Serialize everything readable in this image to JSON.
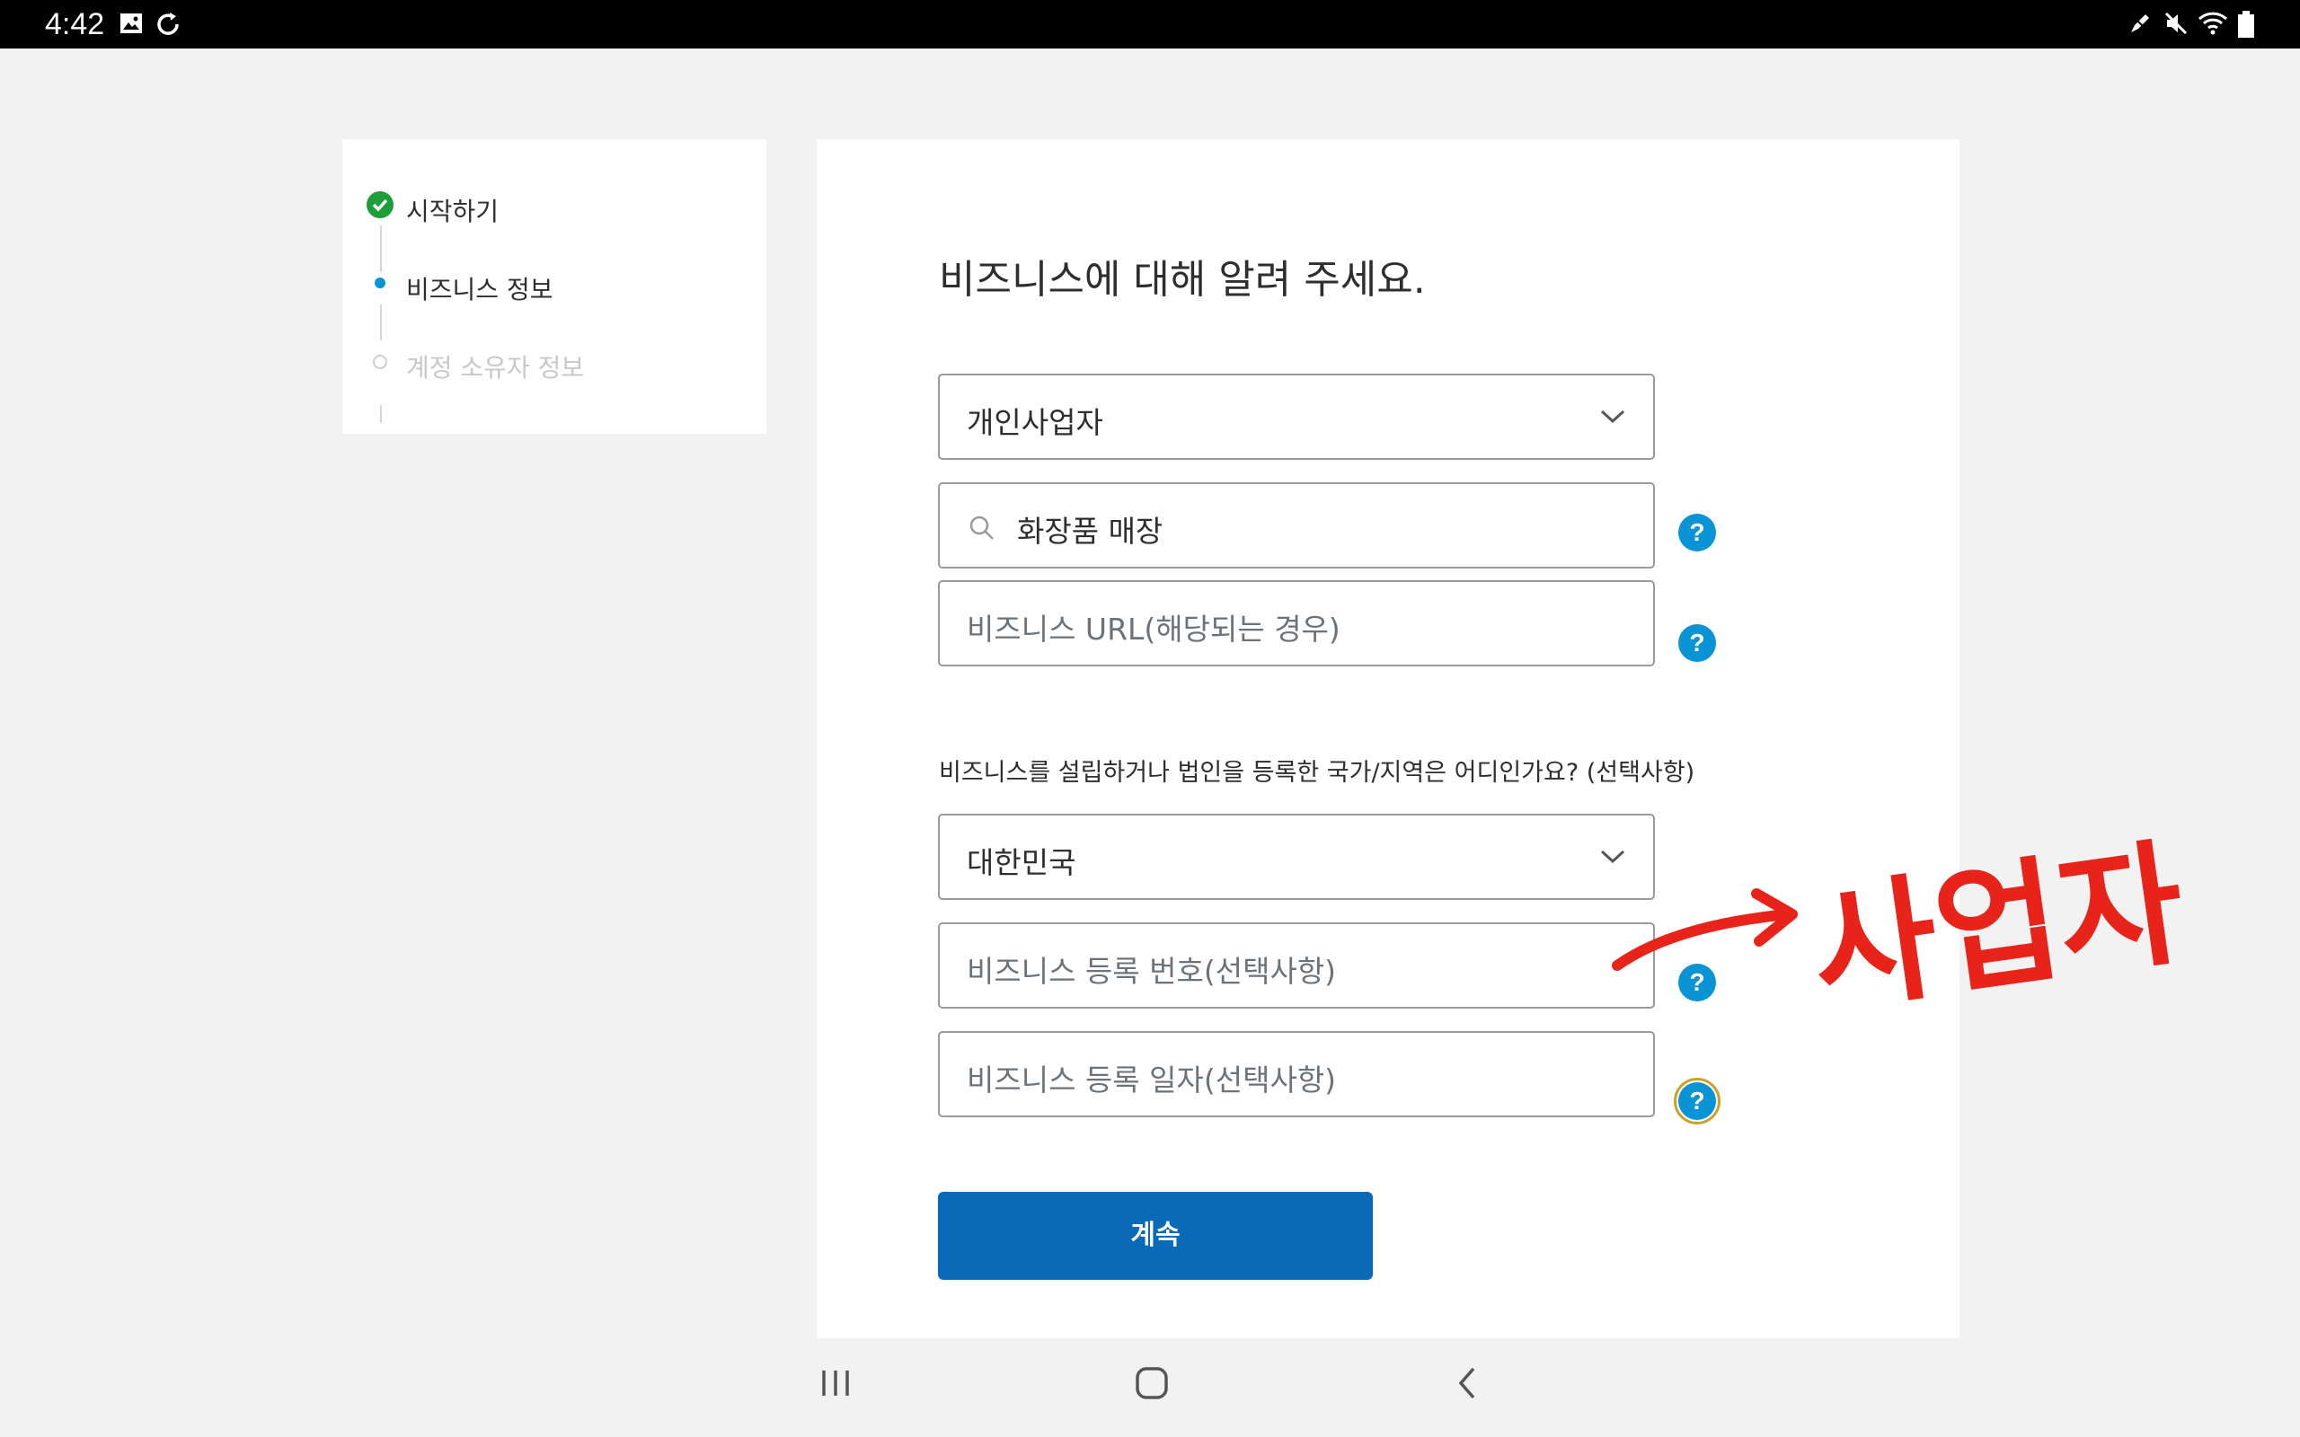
{
  "status_bar": {
    "time": "4:42"
  },
  "stepper": {
    "steps": [
      {
        "label": "시작하기",
        "state": "done"
      },
      {
        "label": "비즈니스 정보",
        "state": "current"
      },
      {
        "label": "계정 소유자 정보",
        "state": "pending"
      }
    ]
  },
  "form": {
    "heading": "비즈니스에 대해 알려 주세요.",
    "business_type": {
      "value": "개인사업자"
    },
    "category": {
      "value": "화장품 매장"
    },
    "url": {
      "placeholder": "비즈니스 URL(해당되는 경우)"
    },
    "country_question": "비즈니스를 설립하거나 법인을 등록한 국가/지역은 어디인가요? (선택사항)",
    "country": {
      "value": "대한민국"
    },
    "reg_number": {
      "placeholder": "비즈니스 등록 번호(선택사항)"
    },
    "reg_date": {
      "placeholder": "비즈니스 등록 일자(선택사항)"
    },
    "help_symbol": "?",
    "continue_label": "계속"
  },
  "annotation": {
    "text": "사업자",
    "color": "#e8241a"
  },
  "colors": {
    "primary_button": "#0b6ab8",
    "help_icon": "#0a94d6",
    "step_done": "#1f9d3a",
    "step_current": "#0a94d6"
  },
  "icons": [
    "image-icon",
    "sync-icon",
    "pen-icon",
    "mute-icon",
    "wifi-icon",
    "battery-icon",
    "check-circle-icon",
    "chevron-down-icon",
    "search-icon",
    "help-icon",
    "recents-icon",
    "home-icon",
    "back-icon"
  ]
}
